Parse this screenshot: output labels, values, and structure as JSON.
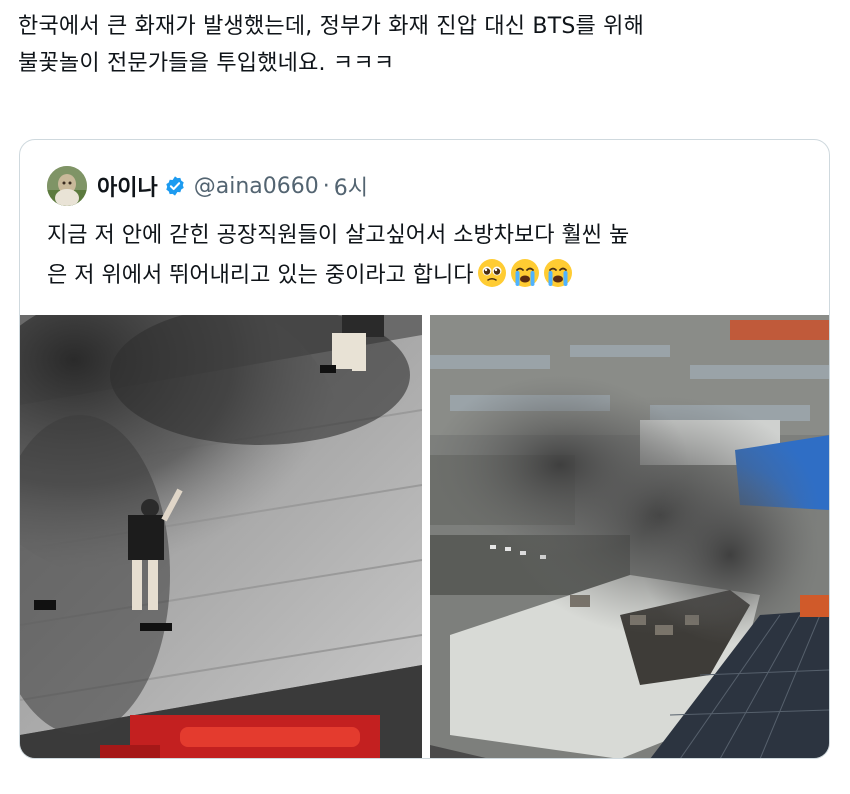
{
  "post": {
    "text_line1": "한국에서 큰 화재가 발생했는데, 정부가 화재 진압 대신 BTS를 위해",
    "text_line2": "불꽃놀이 전문가들을 투입했네요. ㅋㅋㅋ"
  },
  "quote": {
    "display_name": "아이나",
    "handle": "@aina0660",
    "separator": "·",
    "time": "6시",
    "body_line1": "지금 저 안에 갇힌 공장직원들이 살고싶어서 소방차보다 훨씬 높",
    "body_line2": "은 저 위에서 뛰어내리고 있는 중이라고 합니다",
    "emojis": [
      "pleading-face-icon",
      "crying-face-icon",
      "crying-face-icon"
    ],
    "verified_color": "#1d9bf0"
  },
  "media": {
    "images": [
      "photo-workers-on-wall",
      "photo-aerial-factory-fire"
    ]
  }
}
